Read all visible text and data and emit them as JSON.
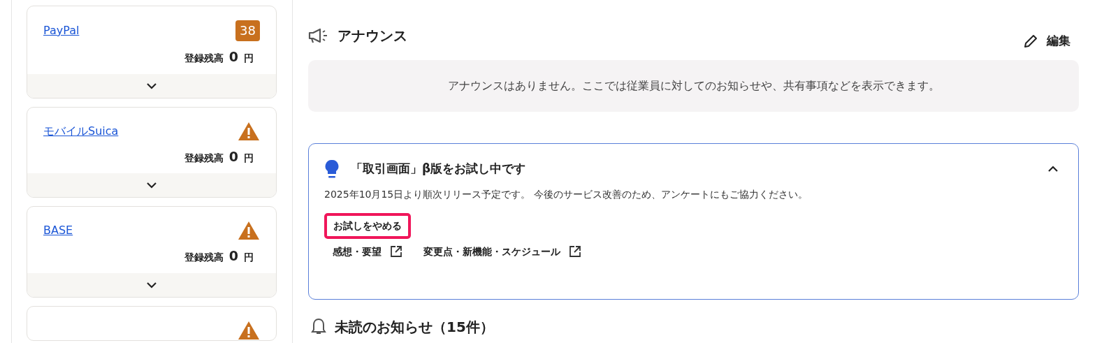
{
  "accounts": [
    {
      "name": "PayPal",
      "status": {
        "kind": "count",
        "text": "38"
      },
      "balance_label": "登録残高",
      "amount": "0",
      "unit": "円",
      "expanded": false
    },
    {
      "name": "モバイルSuica",
      "status": {
        "kind": "warning"
      },
      "balance_label": "登録残高",
      "amount": "0",
      "unit": "円",
      "expanded": false
    },
    {
      "name": "BASE",
      "status": {
        "kind": "warning"
      },
      "balance_label": "登録残高",
      "amount": "0",
      "unit": "円",
      "expanded": false
    },
    {
      "status": {
        "kind": "warning"
      }
    }
  ],
  "announce": {
    "title": "アナウンス",
    "edit": "編集",
    "empty_message": "アナウンスはありません。ここでは従業員に対してのお知らせや、共有事項などを表示できます。"
  },
  "beta": {
    "title": "「取引画面」β版をお試し中です",
    "expanded": true,
    "description": "2025年10月15日より順次リリース予定です。 今後のサービス改善のため、アンケートにもご協力ください。",
    "stop_button": {
      "label": "お試しをやめる",
      "highlighted": true
    },
    "links": [
      "感想・要望",
      "変更点・新機能・スケジュール"
    ]
  },
  "notices": {
    "title": "未読のお知らせ（15件）"
  }
}
